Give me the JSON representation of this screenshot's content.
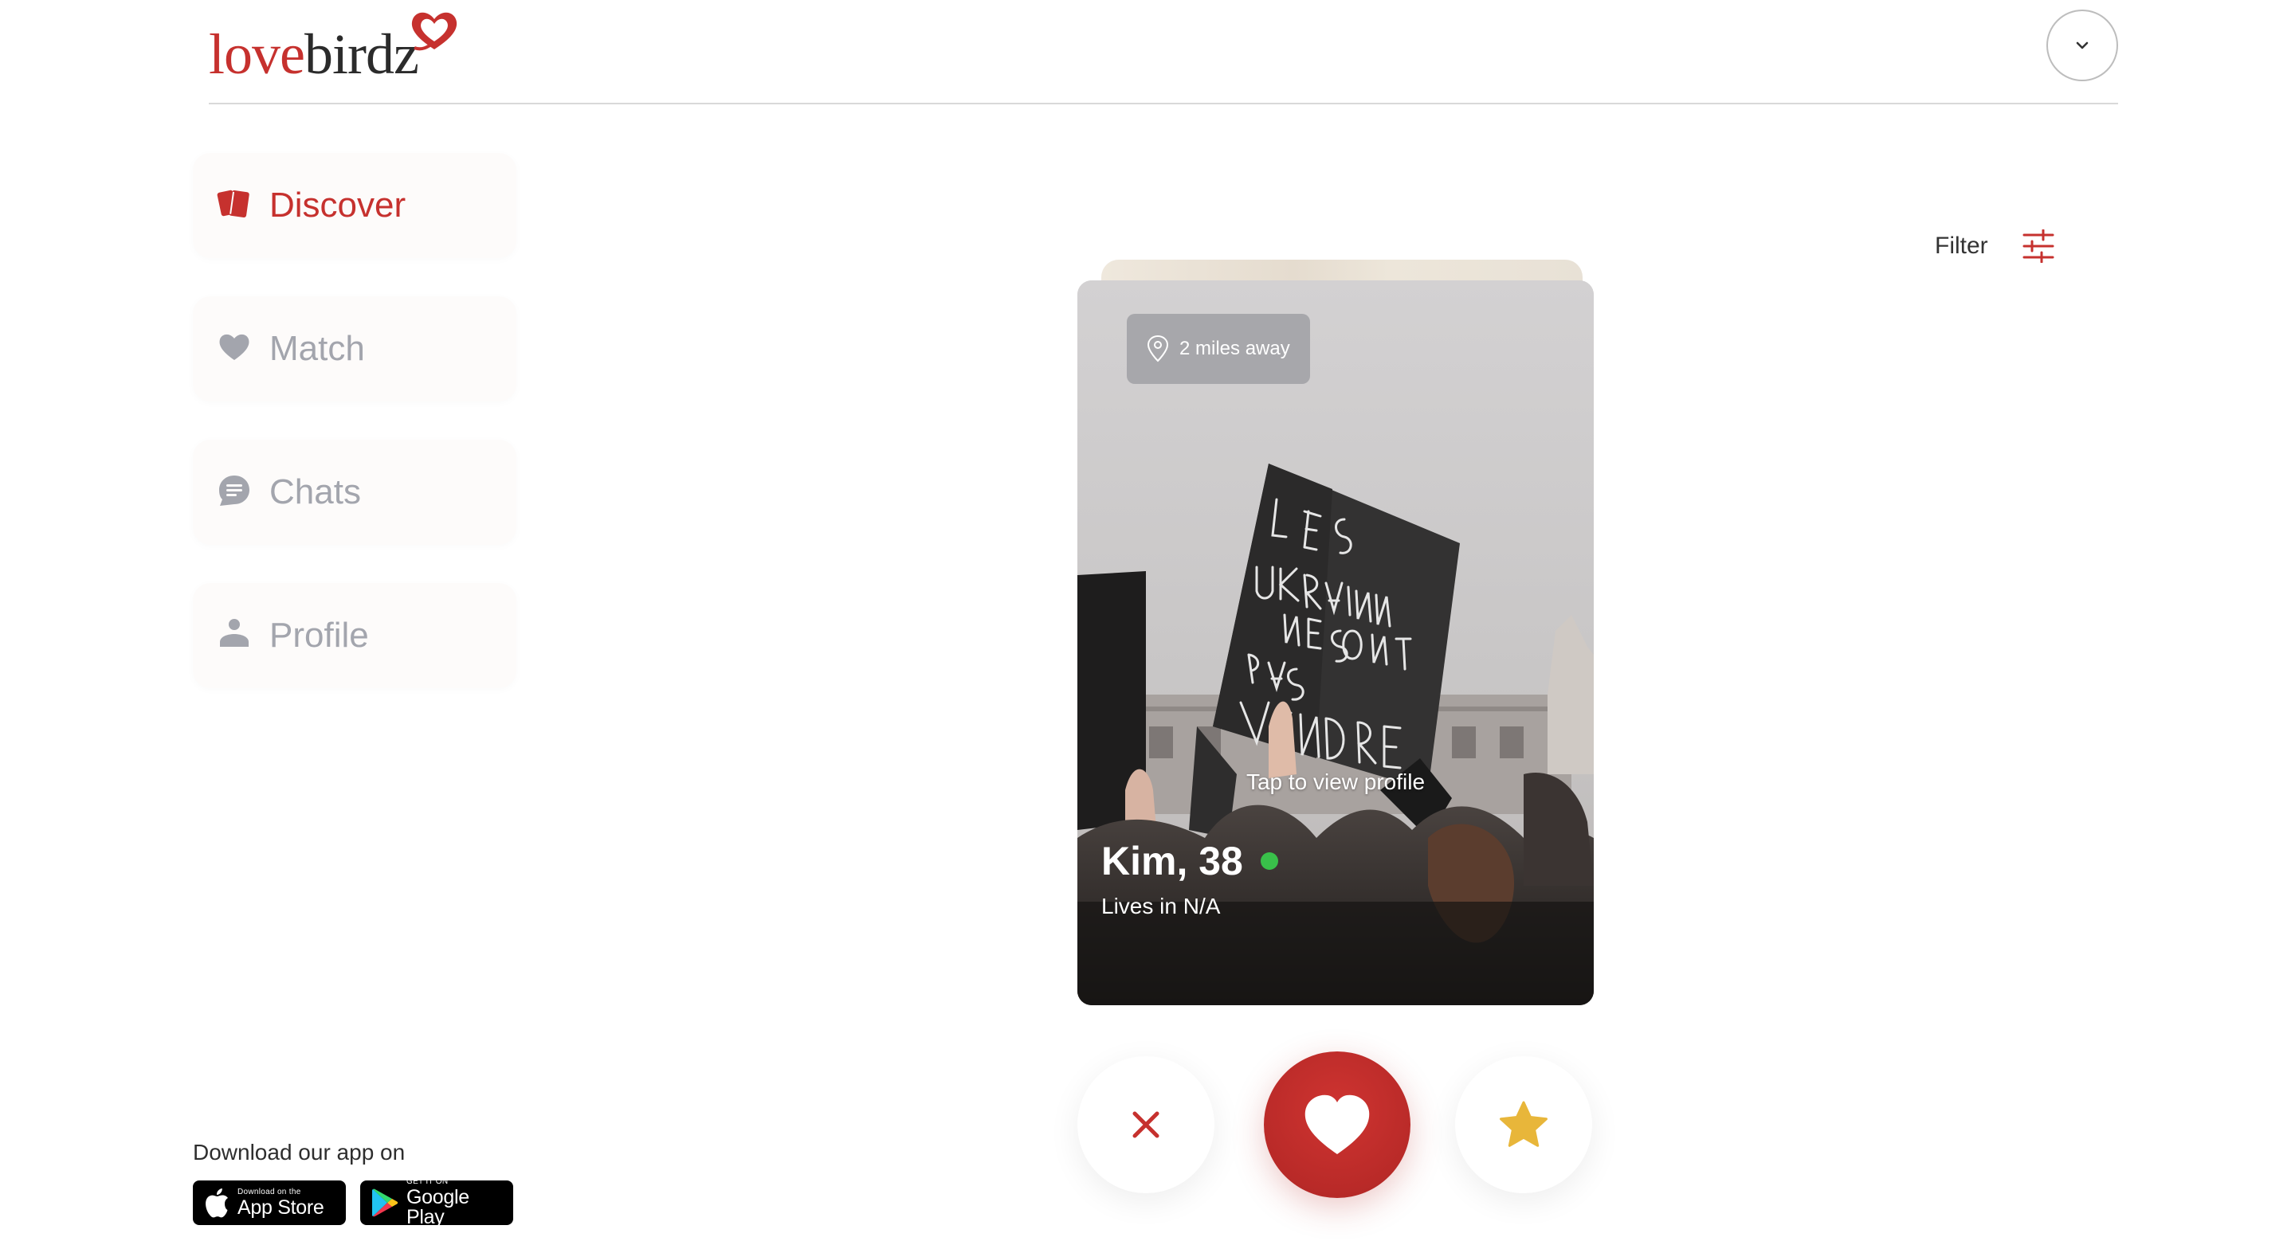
{
  "header": {
    "logo_part1": "love",
    "logo_part2": "birdz"
  },
  "sidebar": {
    "items": [
      {
        "label": "Discover",
        "icon": "cards-icon",
        "active": true
      },
      {
        "label": "Match",
        "icon": "heart-icon",
        "active": false
      },
      {
        "label": "Chats",
        "icon": "chat-bubble-icon",
        "active": false
      },
      {
        "label": "Profile",
        "icon": "person-icon",
        "active": false
      }
    ]
  },
  "download": {
    "label": "Download our app on",
    "appstore_small": "Download on the",
    "appstore_big": "App Store",
    "googleplay_small": "GET IT ON",
    "googleplay_big": "Google Play"
  },
  "filter": {
    "label": "Filter"
  },
  "card": {
    "distance": "2 miles away",
    "tap_hint": "Tap to view profile",
    "name_age": "Kim, 38",
    "location": "Lives in N/A",
    "online": true
  },
  "colors": {
    "brand": "#c6312e",
    "inactive_nav": "#a3a5ad",
    "online": "#39c04a",
    "star": "#e8b63a"
  }
}
